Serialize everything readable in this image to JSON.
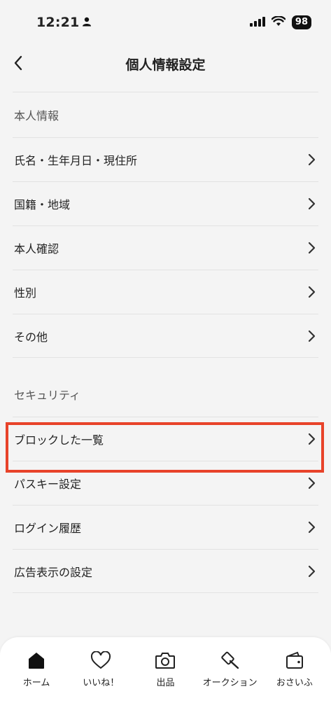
{
  "status_bar": {
    "time": "12:21",
    "battery": "98"
  },
  "header": {
    "title": "個人情報設定"
  },
  "sections": [
    {
      "title": "本人情報",
      "items": [
        {
          "label": "氏名・生年月日・現住所"
        },
        {
          "label": "国籍・地域"
        },
        {
          "label": "本人確認"
        },
        {
          "label": "性別"
        },
        {
          "label": "その他"
        }
      ]
    },
    {
      "title": "セキュリティ",
      "items": [
        {
          "label": "ブロックした一覧"
        },
        {
          "label": "パスキー設定"
        },
        {
          "label": "ログイン履歴"
        },
        {
          "label": "広告表示の設定"
        }
      ]
    }
  ],
  "highlight_color": "#e8432a",
  "tabs": [
    {
      "label": "ホーム",
      "icon": "home-icon",
      "active": true
    },
    {
      "label": "いいね！",
      "icon": "heart-icon"
    },
    {
      "label": "出品",
      "icon": "camera-icon"
    },
    {
      "label": "オークション",
      "icon": "gavel-icon"
    },
    {
      "label": "おさいふ",
      "icon": "wallet-icon"
    }
  ]
}
